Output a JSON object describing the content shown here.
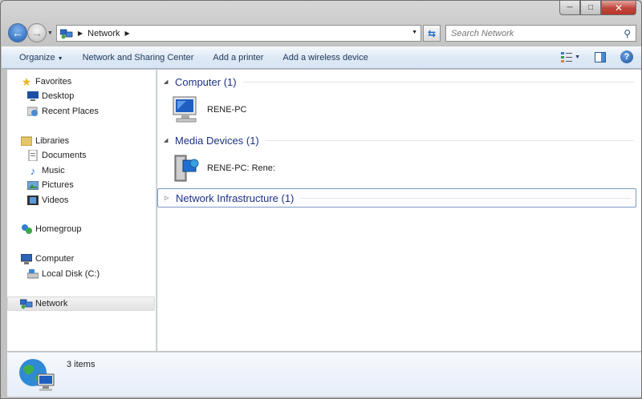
{
  "window": {
    "minimize_label": "─",
    "maximize_label": "□",
    "close_label": "✕"
  },
  "address_bar": {
    "crumbs": [
      "Network"
    ],
    "search_placeholder": "Search Network"
  },
  "command_bar": {
    "organize_label": "Organize",
    "network_sharing_label": "Network and Sharing Center",
    "add_printer_label": "Add a printer",
    "add_wireless_label": "Add a wireless device"
  },
  "nav_pane": {
    "favorites": "Favorites",
    "desktop": "Desktop",
    "recent_places": "Recent Places",
    "libraries": "Libraries",
    "documents": "Documents",
    "music": "Music",
    "pictures": "Pictures",
    "videos": "Videos",
    "homegroup": "Homegroup",
    "computer": "Computer",
    "local_disk": "Local Disk (C:)",
    "network": "Network"
  },
  "groups": {
    "computer": {
      "title": "Computer (1)",
      "items": [
        "RENE-PC"
      ]
    },
    "media": {
      "title": "Media Devices (1)",
      "items": [
        "RENE-PC: Rene:"
      ]
    },
    "infrastructure": {
      "title": "Network Infrastructure (1)"
    }
  },
  "details": {
    "count": "3 items"
  },
  "colors": {
    "accent": "#1e3287",
    "command_text": "#1e395b",
    "close_button": "#c2453a"
  }
}
